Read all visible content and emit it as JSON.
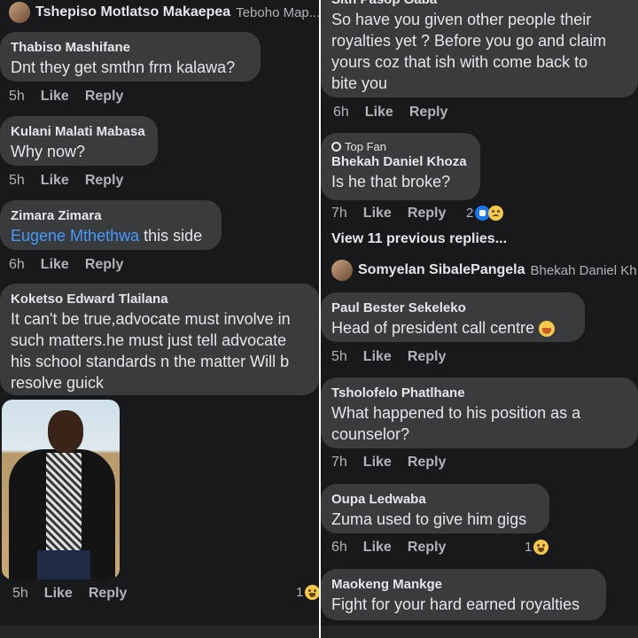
{
  "left": {
    "header": {
      "name": "Tshepiso Motlatso Makaepea",
      "reply_to": "Teboho Map..."
    },
    "comments": [
      {
        "author": "Thabiso Mashifane",
        "text": "Dnt they get smthn frm kalawa?",
        "time": "5h",
        "like": "Like",
        "reply": "Reply"
      },
      {
        "author": "Kulani Malati Mabasa",
        "text": "Why now?",
        "time": "5h",
        "like": "Like",
        "reply": "Reply"
      },
      {
        "author": "Zimara Zimara",
        "mention": "Eugene Mthethwa",
        "text": " this side",
        "time": "6h",
        "like": "Like",
        "reply": "Reply"
      },
      {
        "author": "Koketso Edward Tlailana",
        "text_lines": [
          "It can't be true,advocate must involve in",
          "such matters.he must just tell advocate",
          "his school standards n the matter Will b",
          "resolve guick"
        ],
        "time": "5h",
        "like": "Like",
        "reply": "Reply",
        "reaction_count": "1"
      }
    ]
  },
  "right": {
    "partial_author": "Sith Pasop Gaba",
    "first_comment": {
      "text_lines": [
        "So have you given other people their",
        "royalties yet ? Before you go and claim",
        "yours coz that ish with come back to",
        "bite you"
      ],
      "time": "6h",
      "like": "Like",
      "reply": "Reply"
    },
    "top_fan_label": "Top Fan",
    "bhekah": {
      "author": "Bhekah Daniel Khoza",
      "text": "Is he that broke?",
      "time": "7h",
      "like": "Like",
      "reply": "Reply",
      "reaction_count": "2"
    },
    "view_previous": "View 11 previous replies...",
    "somyelan": {
      "name": "Somyelan SibalePangela",
      "reply_to": "Bhekah Daniel Kh..."
    },
    "comments": [
      {
        "author": "Paul Bester Sekeleko",
        "text": "Head of president call centre",
        "time": "5h",
        "like": "Like",
        "reply": "Reply"
      },
      {
        "author": "Tsholofelo Phatlhane",
        "text_lines": [
          "What happened to his position as a",
          "counselor?"
        ],
        "time": "7h",
        "like": "Like",
        "reply": "Reply"
      },
      {
        "author": "Oupa Ledwaba",
        "text": "Zuma used to give him gigs",
        "time": "6h",
        "like": "Like",
        "reply": "Reply",
        "reaction_count": "1"
      },
      {
        "author": "Maokeng Mankge",
        "text": "Fight for your hard earned royalties"
      }
    ]
  },
  "colors": {
    "background": "#18191a",
    "bubble": "#3a3b3c",
    "text": "#e4e6eb",
    "secondary": "#b0b3b8",
    "mention": "#4599ff"
  },
  "icons": [
    "like-reaction-icon",
    "sad-reaction-icon",
    "haha-reaction-icon",
    "top-fan-badge-icon",
    "facepalm-emoji-icon"
  ]
}
